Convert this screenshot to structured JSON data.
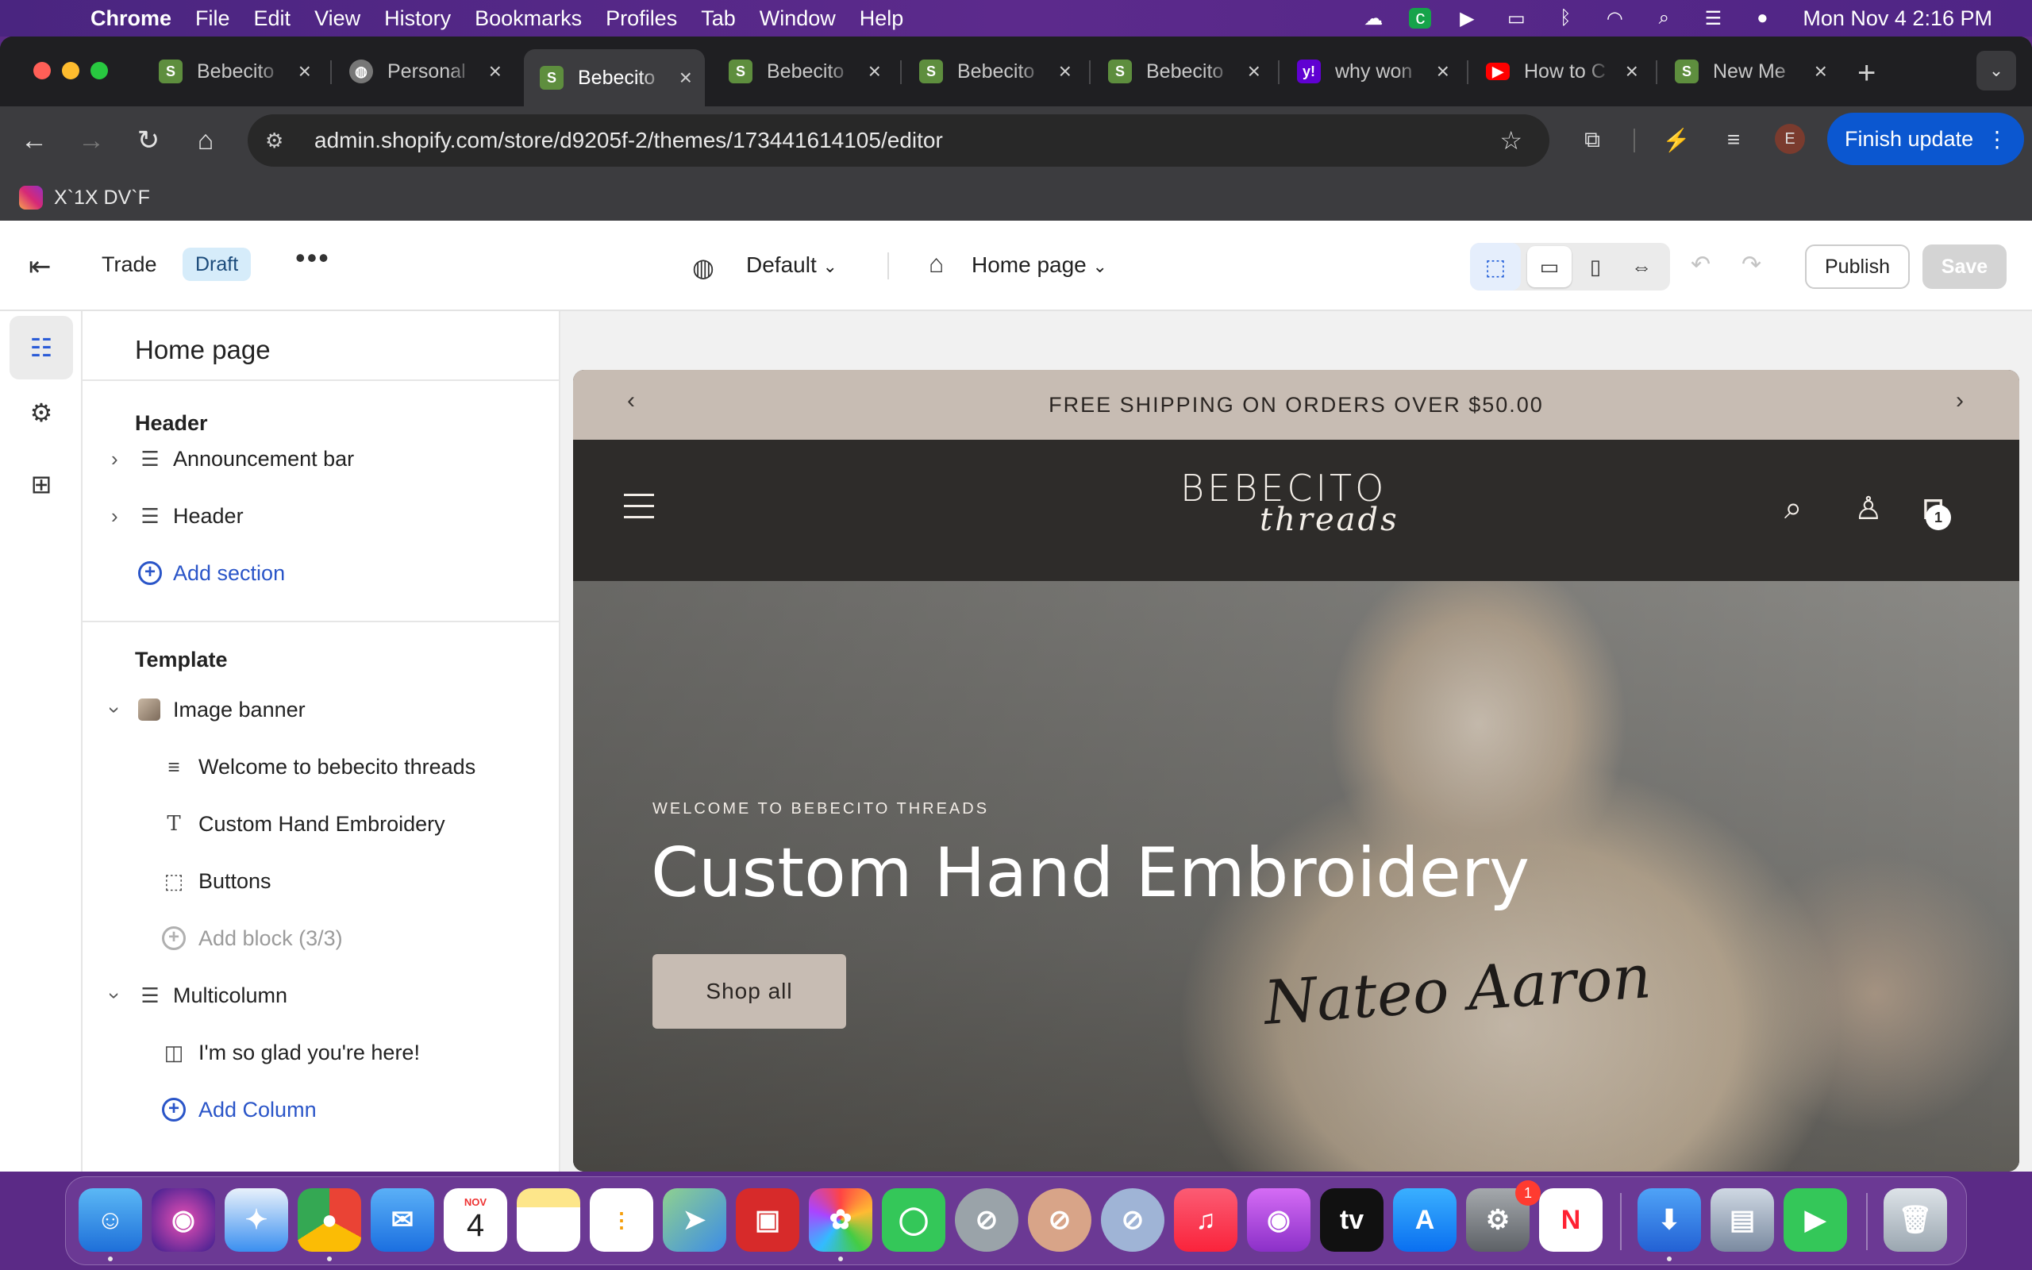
{
  "menubar": {
    "app": "Chrome",
    "items": [
      "File",
      "Edit",
      "View",
      "History",
      "Bookmarks",
      "Profiles",
      "Tab",
      "Window",
      "Help"
    ],
    "clock": "Mon Nov 4  2:16 PM"
  },
  "tabs": [
    {
      "title": "Bebecito",
      "favicon": "shopify-icon",
      "active": false
    },
    {
      "title": "Personal",
      "favicon": "globe-icon",
      "active": false
    },
    {
      "title": "Bebecito",
      "favicon": "shopify-icon",
      "active": true
    },
    {
      "title": "Bebecito",
      "favicon": "shopify-icon",
      "active": false
    },
    {
      "title": "Bebecito",
      "favicon": "shopify-icon",
      "active": false
    },
    {
      "title": "Bebecito",
      "favicon": "shopify-icon",
      "active": false
    },
    {
      "title": "why won",
      "favicon": "yahoo-icon",
      "active": false
    },
    {
      "title": "How to C",
      "favicon": "youtube-icon",
      "active": false
    },
    {
      "title": "New Me",
      "favicon": "shopify-icon",
      "active": false
    }
  ],
  "toolbar": {
    "url": "admin.shopify.com/store/d9205f-2/themes/173441614105/editor",
    "profile_initial": "E",
    "finish_update": "Finish update"
  },
  "bookmarks": [
    {
      "title": "X`1X DV`F"
    }
  ],
  "editor": {
    "theme_name": "Trade",
    "status_badge": "Draft",
    "locale": "Default",
    "template": "Home page",
    "publish": "Publish",
    "save": "Save"
  },
  "panel": {
    "title": "Home page",
    "header_group": "Header",
    "header_items": [
      "Announcement bar",
      "Header"
    ],
    "add_section": "Add section",
    "template_group": "Template",
    "image_banner": "Image banner",
    "banner_blocks": [
      "Welcome to bebecito threads",
      "Custom Hand Embroidery",
      "Buttons"
    ],
    "add_block": "Add block (3/3)",
    "multicolumn": "Multicolumn",
    "multicolumn_blocks": [
      "I'm so glad you're here!"
    ],
    "add_column": "Add Column"
  },
  "preview": {
    "announcement": "FREE SHIPPING ON ORDERS OVER $50.00",
    "logo_main": "BEBECITO",
    "logo_script": "threads",
    "cart_count": "1",
    "kicker": "WELCOME TO BEBECITO THREADS",
    "headline": "Custom Hand Embroidery",
    "button": "Shop all",
    "embroidery_text": "Nateo Aaron"
  },
  "dock": {
    "calendar_month": "NOV",
    "calendar_day": "4",
    "settings_badge": "1"
  },
  "colors": {
    "accent": "#0b57d0",
    "announcement_bg": "#c7bcb3",
    "site_header_bg": "#2e2c2a",
    "link": "#2a55c8"
  }
}
